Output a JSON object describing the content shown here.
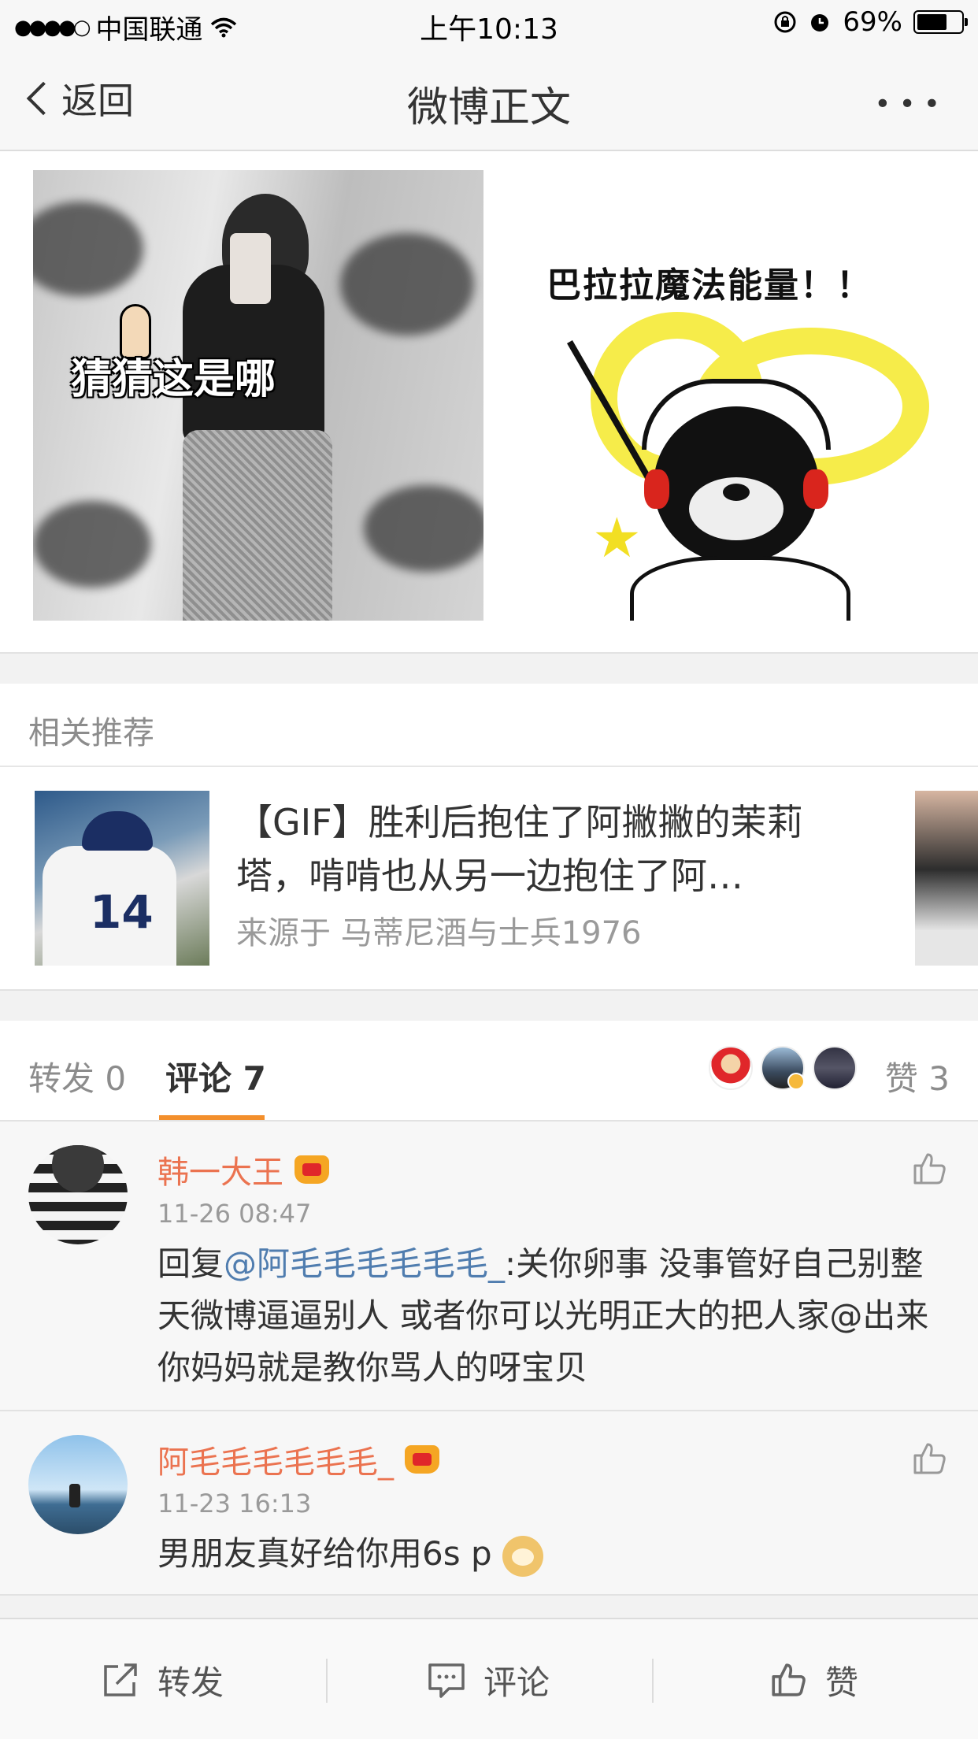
{
  "status_bar": {
    "signal": "●●●●○",
    "carrier": "中国联通",
    "time": "上午10:13",
    "battery_percent": "69%",
    "battery_level": 0.69
  },
  "nav": {
    "back_label": "返回",
    "title": "微博正文",
    "more_label": "•••"
  },
  "images": {
    "image1_text": "猜猜这是哪",
    "image2_text": "巴拉拉魔法能量！！"
  },
  "related": {
    "header": "相关推荐",
    "item": {
      "title": "【GIF】胜利后抱住了阿撇撇的茉莉塔，啃啃也从另一边抱住了阿…",
      "source": "来源于 马蒂尼酒与士兵1976",
      "thumb_number": "14"
    }
  },
  "tabs": {
    "repost": "转发 0",
    "comment": "评论 7",
    "likes": "赞 3"
  },
  "comments": [
    {
      "name": "韩一大王",
      "time": "11-26 08:47",
      "prefix": "回复",
      "mention": "@阿毛毛毛毛毛毛_",
      "text": ":关你卵事 没事管好自己别整天微博逼逼别人 或者你可以光明正大的把人家@出来 你妈妈就是教你骂人的呀宝贝"
    },
    {
      "name": "阿毛毛毛毛毛毛_",
      "time": "11-23 16:13",
      "text": "男朋友真好给你用6s p"
    }
  ],
  "toolbar": {
    "repost": "转发",
    "comment": "评论",
    "like": "赞"
  },
  "colors": {
    "accent_orange": "#f38f2c",
    "username_orange": "#eb7350",
    "mention_blue": "#507daf"
  }
}
